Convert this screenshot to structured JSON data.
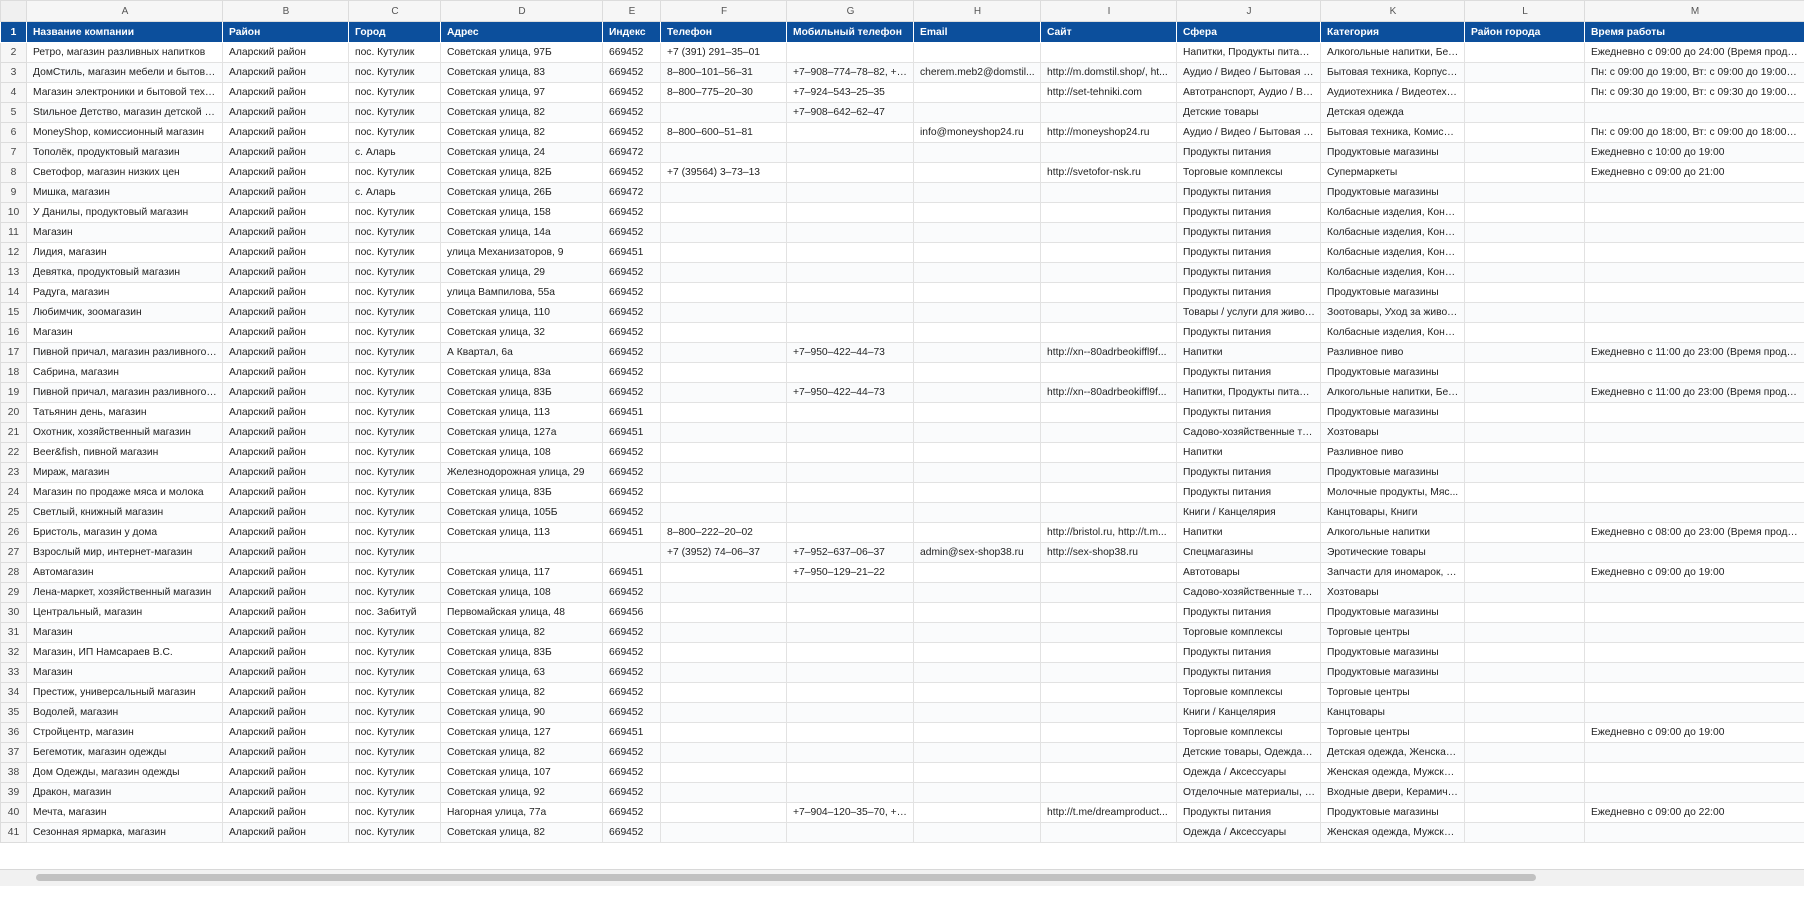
{
  "column_letters": [
    "A",
    "B",
    "C",
    "D",
    "E",
    "F",
    "G",
    "H",
    "I",
    "J",
    "K",
    "L",
    "M"
  ],
  "header_row_number": "1",
  "headers": [
    "Название компании",
    "Район",
    "Город",
    "Адрес",
    "Индекс",
    "Телефон",
    "Мобильный телефон",
    "Email",
    "Сайт",
    "Сфера",
    "Категория",
    "Район города",
    "Время работы"
  ],
  "rows": [
    {
      "n": "2",
      "cells": [
        "Ретро, магазин разливных напитков",
        "Аларский район",
        "пос. Кутулик",
        "Советская улица, 97Б",
        "669452",
        "+7 (391) 291‒35‒01",
        "",
        "",
        "",
        "Напитки, Продукты питания",
        "Алкогольные напитки, Без...",
        "",
        "Ежедневно с 09:00 до 24:00 (Время прода..."
      ]
    },
    {
      "n": "3",
      "cells": [
        "ДомСтиль, магазин мебели и бытово...",
        "Аларский район",
        "пос. Кутулик",
        "Советская улица, 83",
        "669452",
        "8‒800‒101‒56‒31",
        "+7‒908‒774‒78‒82, +7...",
        "cherem.meb2@domstil...",
        "http://m.domstil.shop/, ht...",
        "Аудио / Видео / Бытовая т...",
        "Бытовая техника, Корпусн...",
        "",
        "Пн: с 09:00 до 19:00, Вт: с 09:00 до 19:00, С..."
      ]
    },
    {
      "n": "4",
      "cells": [
        "Магазин электроники и бытовой техн...",
        "Аларский район",
        "пос. Кутулик",
        "Советская улица, 97",
        "669452",
        "8‒800‒775‒20‒30",
        "+7‒924‒543‒25‒35",
        "",
        "http://set-tehniki.com",
        "Автотранспорт, Аудио / Ви...",
        "Аудиотехника / Видеотехн...",
        "",
        "Пн: с 09:30 до 19:00, Вт: с 09:30 до 19:00, С..."
      ]
    },
    {
      "n": "5",
      "cells": [
        "Stильное Детство, магазин детской о...",
        "Аларский район",
        "пос. Кутулик",
        "Советская улица, 82",
        "669452",
        "",
        "+7‒908‒642‒62‒47",
        "",
        "",
        "Детские товары",
        "Детская одежда",
        "",
        ""
      ]
    },
    {
      "n": "6",
      "cells": [
        "MoneyShop, комиссионный магазин",
        "Аларский район",
        "пос. Кутулик",
        "Советская улица, 82",
        "669452",
        "8‒800‒600‒51‒81",
        "",
        "info@moneyshop24.ru",
        "http://moneyshop24.ru",
        "Аудио / Видео / Бытовая т...",
        "Бытовая техника, Комисси...",
        "",
        "Пн: с 09:00 до 18:00, Вт: с 09:00 до 18:00, С..."
      ]
    },
    {
      "n": "7",
      "cells": [
        "Тополёк, продуктовый магазин",
        "Аларский район",
        "с. Аларь",
        "Советская улица, 24",
        "669472",
        "",
        "",
        "",
        "",
        "Продукты питания",
        "Продуктовые магазины",
        "",
        "Ежедневно с 10:00 до 19:00"
      ]
    },
    {
      "n": "8",
      "cells": [
        "Светофор, магазин низких цен",
        "Аларский район",
        "пос. Кутулик",
        "Советская улица, 82Б",
        "669452",
        "+7 (39564) 3‒73‒13",
        "",
        "",
        "http://svetofor-nsk.ru",
        "Торговые комплексы",
        "Супермаркеты",
        "",
        "Ежедневно с 09:00 до 21:00"
      ]
    },
    {
      "n": "9",
      "cells": [
        "Мишка, магазин",
        "Аларский район",
        "с. Аларь",
        "Советская улица, 26Б",
        "669472",
        "",
        "",
        "",
        "",
        "Продукты питания",
        "Продуктовые магазины",
        "",
        ""
      ]
    },
    {
      "n": "10",
      "cells": [
        "У Данилы, продуктовый магазин",
        "Аларский район",
        "пос. Кутулик",
        "Советская улица, 158",
        "669452",
        "",
        "",
        "",
        "",
        "Продукты питания",
        "Колбасные изделия, Конд...",
        "",
        ""
      ]
    },
    {
      "n": "11",
      "cells": [
        "Магазин",
        "Аларский район",
        "пос. Кутулик",
        "Советская улица, 14а",
        "669452",
        "",
        "",
        "",
        "",
        "Продукты питания",
        "Колбасные изделия, Конд...",
        "",
        ""
      ]
    },
    {
      "n": "12",
      "cells": [
        "Лидия, магазин",
        "Аларский район",
        "пос. Кутулик",
        "улица Механизаторов, 9",
        "669451",
        "",
        "",
        "",
        "",
        "Продукты питания",
        "Колбасные изделия, Конд...",
        "",
        ""
      ]
    },
    {
      "n": "13",
      "cells": [
        "Девятка, продуктовый магазин",
        "Аларский район",
        "пос. Кутулик",
        "Советская улица, 29",
        "669452",
        "",
        "",
        "",
        "",
        "Продукты питания",
        "Колбасные изделия, Конд...",
        "",
        ""
      ]
    },
    {
      "n": "14",
      "cells": [
        "Радуга, магазин",
        "Аларский район",
        "пос. Кутулик",
        "улица Вампилова, 55а",
        "669452",
        "",
        "",
        "",
        "",
        "Продукты питания",
        "Продуктовые магазины",
        "",
        ""
      ]
    },
    {
      "n": "15",
      "cells": [
        "Любимчик, зоомагазин",
        "Аларский район",
        "пос. Кутулик",
        "Советская улица, 110",
        "669452",
        "",
        "",
        "",
        "",
        "Товары / услуги для живот...",
        "Зоотовары, Уход за живот...",
        "",
        ""
      ]
    },
    {
      "n": "16",
      "cells": [
        "Магазин",
        "Аларский район",
        "пос. Кутулик",
        "Советская улица, 32",
        "669452",
        "",
        "",
        "",
        "",
        "Продукты питания",
        "Колбасные изделия, Конд...",
        "",
        ""
      ]
    },
    {
      "n": "17",
      "cells": [
        "Пивной причал, магазин разливного ...",
        "Аларский район",
        "пос. Кутулик",
        "А Квартал, 6а",
        "669452",
        "",
        "+7‒950‒422‒44‒73",
        "",
        "http://xn--80adrbeokiffl9f...",
        "Напитки",
        "Разливное пиво",
        "",
        "Ежедневно с 11:00 до 23:00 (Время прода..."
      ]
    },
    {
      "n": "18",
      "cells": [
        "Сабрина, магазин",
        "Аларский район",
        "пос. Кутулик",
        "Советская улица, 83а",
        "669452",
        "",
        "",
        "",
        "",
        "Продукты питания",
        "Продуктовые магазины",
        "",
        ""
      ]
    },
    {
      "n": "19",
      "cells": [
        "Пивной причал, магазин разливного ...",
        "Аларский район",
        "пос. Кутулик",
        "Советская улица, 83Б",
        "669452",
        "",
        "+7‒950‒422‒44‒73",
        "",
        "http://xn--80adrbeokiffl9f...",
        "Напитки, Продукты питания",
        "Алкогольные напитки, Без...",
        "",
        "Ежедневно с 11:00 до 23:00 (Время прода..."
      ]
    },
    {
      "n": "20",
      "cells": [
        "Татьянин день, магазин",
        "Аларский район",
        "пос. Кутулик",
        "Советская улица, 113",
        "669451",
        "",
        "",
        "",
        "",
        "Продукты питания",
        "Продуктовые магазины",
        "",
        ""
      ]
    },
    {
      "n": "21",
      "cells": [
        "Охотник, хозяйственный магазин",
        "Аларский район",
        "пос. Кутулик",
        "Советская улица, 127а",
        "669451",
        "",
        "",
        "",
        "",
        "Садово-хозяйственные то...",
        "Хозтовары",
        "",
        ""
      ]
    },
    {
      "n": "22",
      "cells": [
        "Beer&fish, пивной магазин",
        "Аларский район",
        "пос. Кутулик",
        "Советская улица, 108",
        "669452",
        "",
        "",
        "",
        "",
        "Напитки",
        "Разливное пиво",
        "",
        ""
      ]
    },
    {
      "n": "23",
      "cells": [
        "Мираж, магазин",
        "Аларский район",
        "пос. Кутулик",
        "Железнодорожная улица, 29",
        "669452",
        "",
        "",
        "",
        "",
        "Продукты питания",
        "Продуктовые магазины",
        "",
        ""
      ]
    },
    {
      "n": "24",
      "cells": [
        "Магазин по продаже мяса и молока",
        "Аларский район",
        "пос. Кутулик",
        "Советская улица, 83Б",
        "669452",
        "",
        "",
        "",
        "",
        "Продукты питания",
        "Молочные продукты, Мяс...",
        "",
        ""
      ]
    },
    {
      "n": "25",
      "cells": [
        "Светлый, книжный магазин",
        "Аларский район",
        "пос. Кутулик",
        "Советская улица, 105Б",
        "669452",
        "",
        "",
        "",
        "",
        "Книги / Канцелярия",
        "Канцтовары, Книги",
        "",
        ""
      ]
    },
    {
      "n": "26",
      "cells": [
        "Бристоль, магазин у дома",
        "Аларский район",
        "пос. Кутулик",
        "Советская улица, 113",
        "669451",
        "8‒800‒222‒20‒02",
        "",
        "",
        "http://bristol.ru, http://t.m...",
        "Напитки",
        "Алкогольные напитки",
        "",
        "Ежедневно с 08:00 до 23:00 (Время прода..."
      ]
    },
    {
      "n": "27",
      "cells": [
        "Взрослый мир, интернет-магазин",
        "Аларский район",
        "пос. Кутулик",
        "",
        "",
        "+7 (3952) 74‒06‒37",
        "+7‒952‒637‒06‒37",
        "admin@sex-shop38.ru",
        "http://sex-shop38.ru",
        "Спецмагазины",
        "Эротические товары",
        "",
        ""
      ]
    },
    {
      "n": "28",
      "cells": [
        "Автомагазин",
        "Аларский район",
        "пос. Кутулик",
        "Советская улица, 117",
        "669451",
        "",
        "+7‒950‒129‒21‒22",
        "",
        "",
        "Автотовары",
        "Запчасти для иномарок, З...",
        "",
        "Ежедневно с 09:00 до 19:00"
      ]
    },
    {
      "n": "29",
      "cells": [
        "Лена-маркет, хозяйственный магазин",
        "Аларский район",
        "пос. Кутулик",
        "Советская улица, 108",
        "669452",
        "",
        "",
        "",
        "",
        "Садово-хозяйственные то...",
        "Хозтовары",
        "",
        ""
      ]
    },
    {
      "n": "30",
      "cells": [
        "Центральный, магазин",
        "Аларский район",
        "пос. Забитуй",
        "Первомайская улица, 48",
        "669456",
        "",
        "",
        "",
        "",
        "Продукты питания",
        "Продуктовые магазины",
        "",
        ""
      ]
    },
    {
      "n": "31",
      "cells": [
        "Магазин",
        "Аларский район",
        "пос. Кутулик",
        "Советская улица, 82",
        "669452",
        "",
        "",
        "",
        "",
        "Торговые комплексы",
        "Торговые центры",
        "",
        ""
      ]
    },
    {
      "n": "32",
      "cells": [
        "Магазин, ИП Намсараев В.С.",
        "Аларский район",
        "пос. Кутулик",
        "Советская улица, 83Б",
        "669452",
        "",
        "",
        "",
        "",
        "Продукты питания",
        "Продуктовые магазины",
        "",
        ""
      ]
    },
    {
      "n": "33",
      "cells": [
        "Магазин",
        "Аларский район",
        "пос. Кутулик",
        "Советская улица, 63",
        "669452",
        "",
        "",
        "",
        "",
        "Продукты питания",
        "Продуктовые магазины",
        "",
        ""
      ]
    },
    {
      "n": "34",
      "cells": [
        "Престиж, универсальный магазин",
        "Аларский район",
        "пос. Кутулик",
        "Советская улица, 82",
        "669452",
        "",
        "",
        "",
        "",
        "Торговые комплексы",
        "Торговые центры",
        "",
        ""
      ]
    },
    {
      "n": "35",
      "cells": [
        "Водолей, магазин",
        "Аларский район",
        "пос. Кутулик",
        "Советская улица, 90",
        "669452",
        "",
        "",
        "",
        "",
        "Книги / Канцелярия",
        "Канцтовары",
        "",
        ""
      ]
    },
    {
      "n": "36",
      "cells": [
        "Стройцентр, магазин",
        "Аларский район",
        "пос. Кутулик",
        "Советская улица, 127",
        "669451",
        "",
        "",
        "",
        "",
        "Торговые комплексы",
        "Торговые центры",
        "",
        "Ежедневно с 09:00 до 19:00"
      ]
    },
    {
      "n": "37",
      "cells": [
        "Бегемотик, магазин одежды",
        "Аларский район",
        "пос. Кутулик",
        "Советская улица, 82",
        "669452",
        "",
        "",
        "",
        "",
        "Детские товары, Одежда / ...",
        "Детская одежда, Женская ...",
        "",
        ""
      ]
    },
    {
      "n": "38",
      "cells": [
        "Дом Одежды, магазин одежды",
        "Аларский район",
        "пос. Кутулик",
        "Советская улица, 107",
        "669452",
        "",
        "",
        "",
        "",
        "Одежда / Аксессуары",
        "Женская одежда, Мужская...",
        "",
        ""
      ]
    },
    {
      "n": "39",
      "cells": [
        "Дракон, магазин",
        "Аларский район",
        "пос. Кутулик",
        "Советская улица, 92",
        "669452",
        "",
        "",
        "",
        "",
        "Отделочные материалы, С...",
        "Входные двери, Керамиче...",
        "",
        ""
      ]
    },
    {
      "n": "40",
      "cells": [
        "Мечта, магазин",
        "Аларский район",
        "пос. Кутулик",
        "Нагорная улица, 77а",
        "669452",
        "",
        "+7‒904‒120‒35‒70, +7...",
        "",
        "http://t.me/dreamproduct...",
        "Продукты питания",
        "Продуктовые магазины",
        "",
        "Ежедневно с 09:00 до 22:00"
      ]
    },
    {
      "n": "41",
      "cells": [
        "Сезонная ярмарка, магазин",
        "Аларский район",
        "пос. Кутулик",
        "Советская улица, 82",
        "669452",
        "",
        "",
        "",
        "",
        "Одежда / Аксессуары",
        "Женская одежда, Мужская...",
        "",
        ""
      ]
    }
  ],
  "colors": {
    "header_bg": "#0c4f9c",
    "header_text": "#ffffff",
    "grid": "#e2e2e2"
  }
}
